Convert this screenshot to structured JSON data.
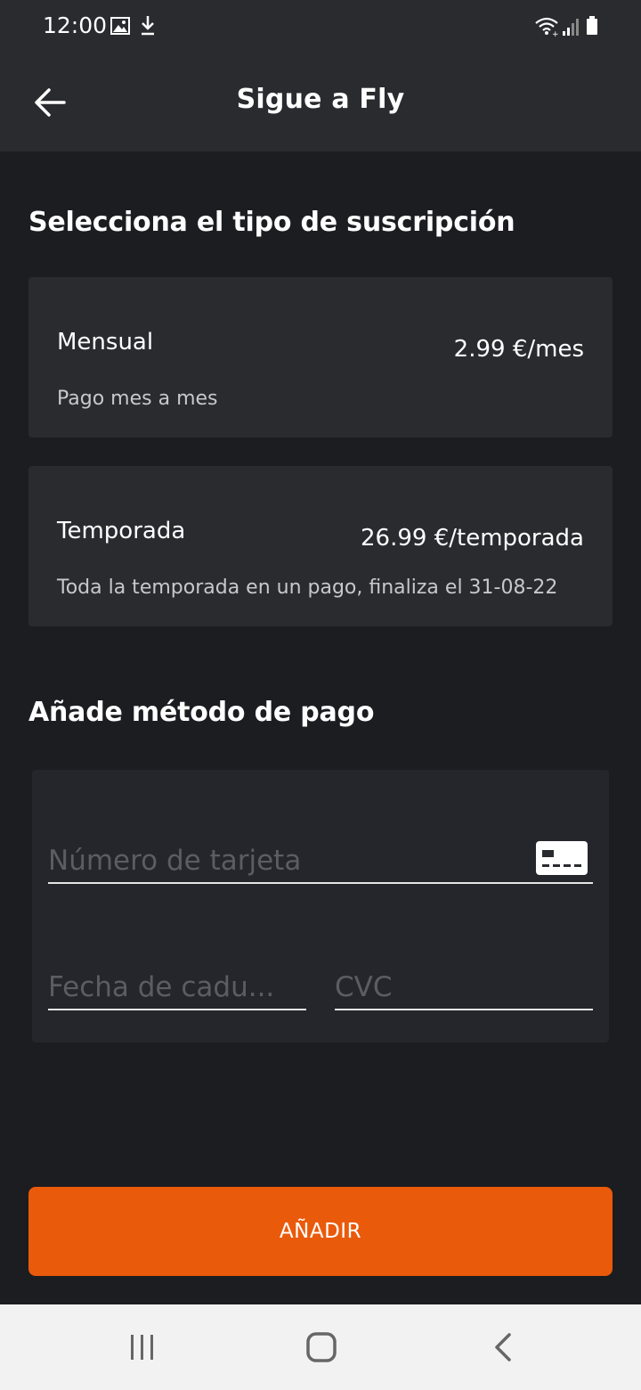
{
  "status_bar": {
    "time": "12:00",
    "icons": [
      "image-icon",
      "download-icon",
      "wifi-icon",
      "signal-icon",
      "battery-icon"
    ]
  },
  "app_bar": {
    "title": "Sigue a Fly",
    "back_icon": "arrow-left-icon"
  },
  "subscription": {
    "heading": "Selecciona el tipo de suscripción",
    "plans": [
      {
        "name": "Mensual",
        "price": "2.99 €/mes",
        "description": "Pago mes a mes"
      },
      {
        "name": "Temporada",
        "price": "26.99 €/temporada",
        "description": "Toda la temporada en un pago, finaliza el 31-08-22"
      }
    ]
  },
  "payment": {
    "heading": "Añade método de pago",
    "card_number_placeholder": "Número de tarjeta",
    "expiry_placeholder": "Fecha de cadu...",
    "cvc_placeholder": "CVC",
    "card_icon": "credit-card-icon"
  },
  "actions": {
    "add_label": "AÑADIR"
  },
  "nav_bar": {
    "icons": [
      "recents-icon",
      "home-icon",
      "back-icon"
    ]
  },
  "colors": {
    "background": "#1c1d21",
    "surface": "#2a2b2f",
    "accent": "#ea5a0b",
    "placeholder": "#5b5d63"
  }
}
